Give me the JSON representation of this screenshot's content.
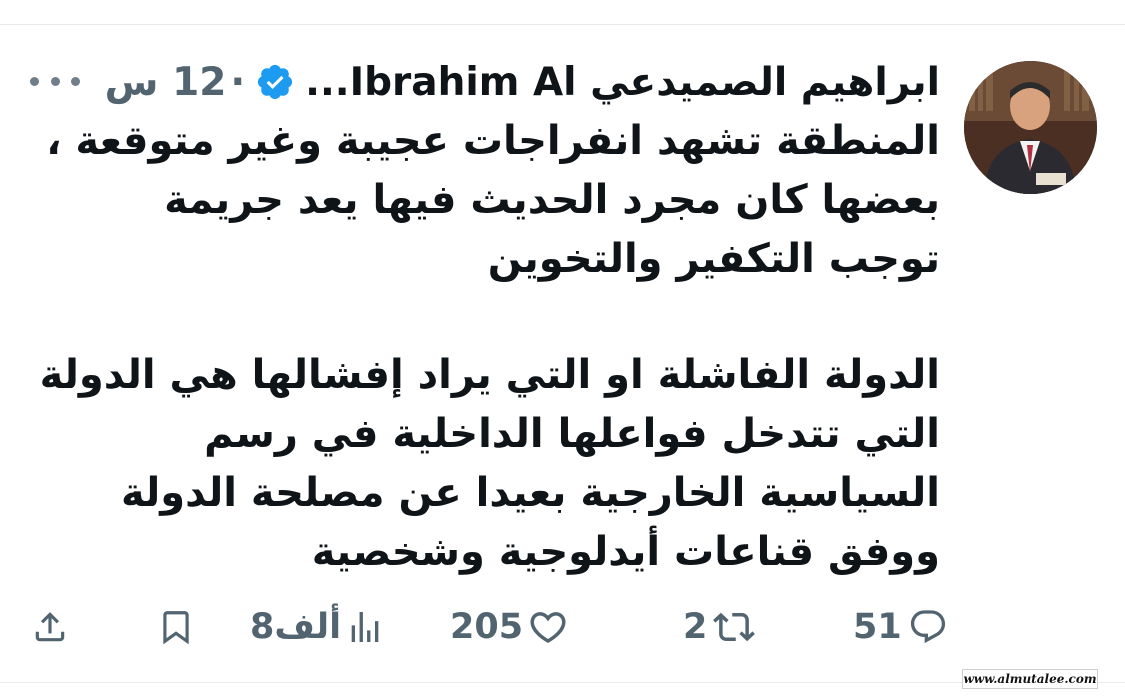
{
  "tweet": {
    "author_name": "ابراهيم الصميدعي Ibrahim Al...",
    "time": "12 س",
    "dot": "·",
    "lines": [
      "المنطقة تشهد انفراجات عجيبة وغير متوقعة ،",
      "بعضها كان مجرد الحديث فيها يعد جريمة",
      "توجب  التكفير والتخوين",
      "الدولة الفاشلة او التي يراد إفشالها هي الدولة",
      "التي تتدخل فواعلها الداخلية في رسم",
      "السياسية الخارجية بعيدا عن مصلحة الدولة",
      "ووفق قناعات أيدلوجية وشخصية"
    ]
  },
  "actions": {
    "replies": "51",
    "retweets": "2",
    "likes": "205",
    "views": "8ألف"
  },
  "icons": {
    "more": "more-options-icon",
    "verified": "verified-badge-icon",
    "reply": "reply-icon",
    "retweet": "retweet-icon",
    "like": "heart-icon",
    "views": "views-chart-icon",
    "bookmark": "bookmark-icon",
    "share": "share-icon"
  },
  "colors": {
    "text": "#0f1419",
    "muted": "#536471",
    "verified": "#1d9bf0"
  },
  "watermark": "www.almutalee.com"
}
